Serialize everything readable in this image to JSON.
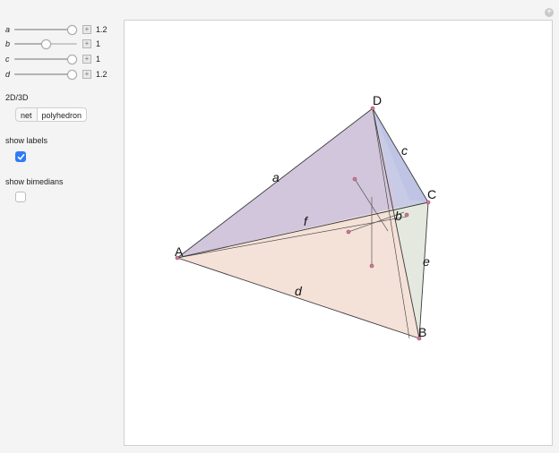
{
  "sliders": [
    {
      "label": "a",
      "value": "1.2",
      "level": 0.92
    },
    {
      "label": "b",
      "value": "1",
      "level": 0.48
    },
    {
      "label": "c",
      "value": "1",
      "level": 0.92
    },
    {
      "label": "d",
      "value": "1.2",
      "level": 0.92
    }
  ],
  "mode": {
    "label": "2D/3D",
    "options": [
      "net",
      "polyhedron"
    ],
    "selected": "polyhedron"
  },
  "show_labels": {
    "label": "show labels",
    "checked": true
  },
  "show_bimedians": {
    "label": "show bimedians",
    "checked": false
  },
  "figure": {
    "vertices": {
      "A": "A",
      "B": "B",
      "C": "C",
      "D": "D"
    },
    "edges": {
      "a": "a",
      "b": "b",
      "c": "c",
      "d": "d",
      "e": "e",
      "f": "f"
    }
  },
  "colors": {
    "face_purple": "#d2c6dc",
    "face_peach": "#f4ddd1",
    "face_green": "#e4e8df",
    "face_blue": "#c7cbe6",
    "checkbox": "#2f7bf6"
  }
}
